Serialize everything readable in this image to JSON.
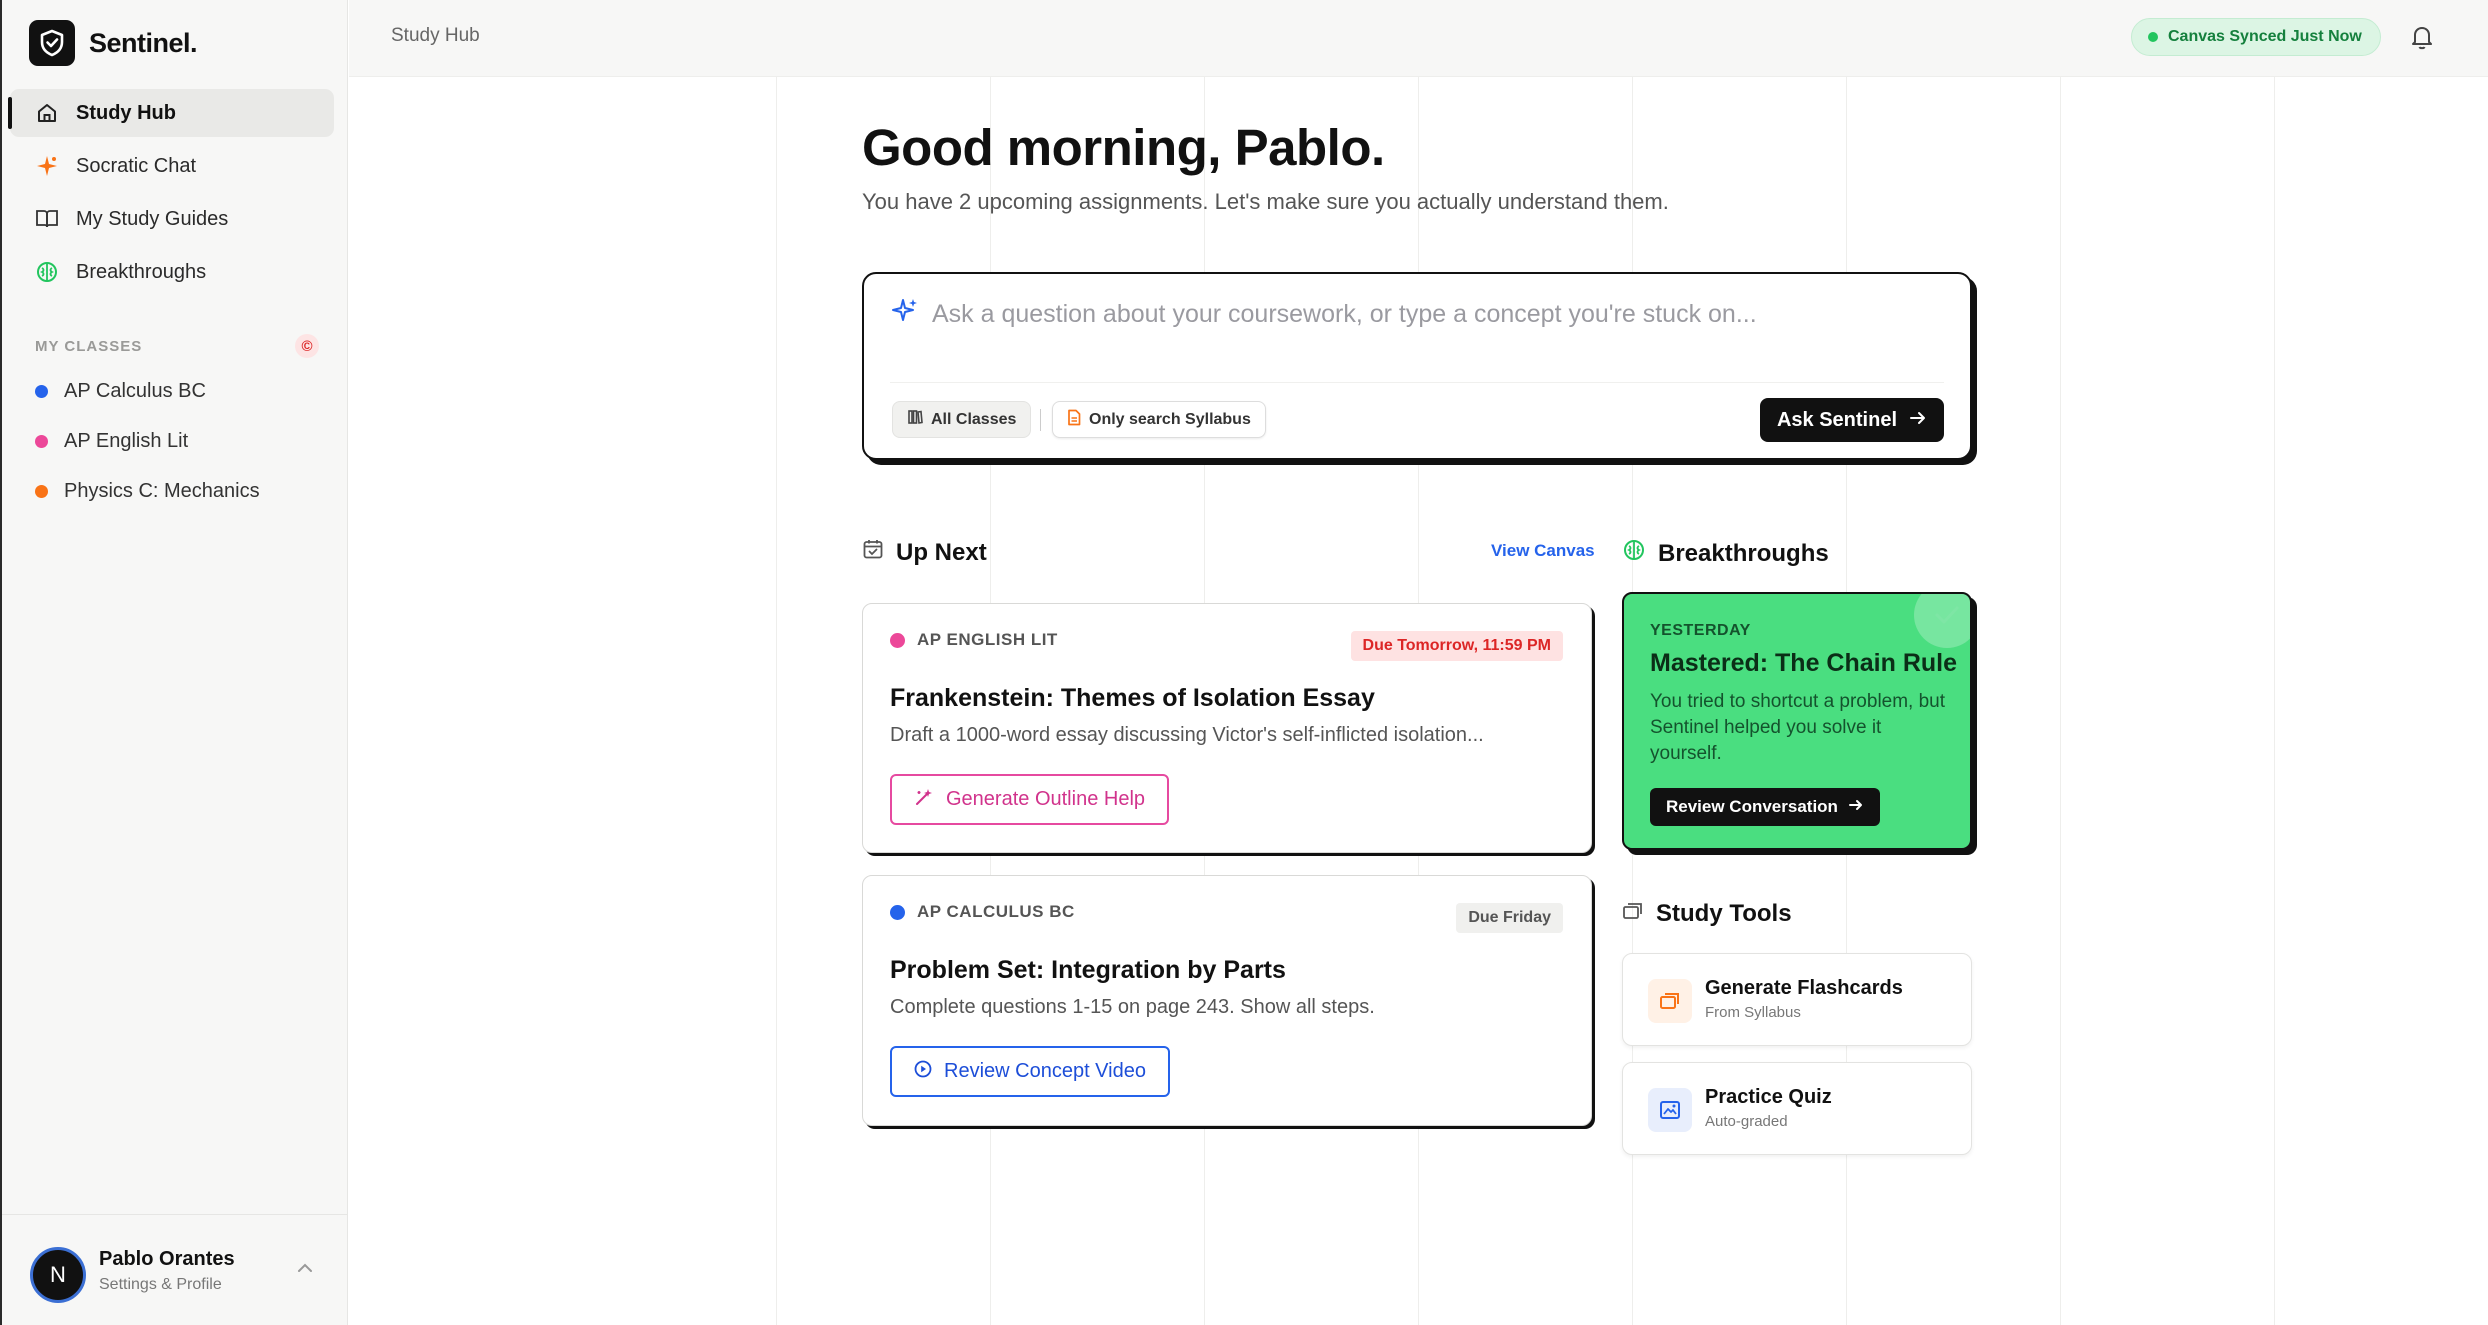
{
  "app": {
    "name": "Sentinel."
  },
  "sidebar": {
    "nav": [
      {
        "label": "Study Hub",
        "icon": "home-icon",
        "active": true
      },
      {
        "label": "Socratic Chat",
        "icon": "sparkle-chat-icon",
        "active": false
      },
      {
        "label": "My Study Guides",
        "icon": "book-icon",
        "active": false
      },
      {
        "label": "Breakthroughs",
        "icon": "brain-icon",
        "active": false
      }
    ],
    "classes_title": "MY CLASSES",
    "classes_badge": "©",
    "classes": [
      {
        "name": "AP Calculus BC",
        "color": "#2563eb"
      },
      {
        "name": "AP English Lit",
        "color": "#ec4899"
      },
      {
        "name": "Physics C: Mechanics",
        "color": "#f97316"
      }
    ],
    "profile": {
      "initial": "N",
      "name": "Pablo Orantes",
      "subtitle": "Settings & Profile"
    }
  },
  "topbar": {
    "breadcrumb": "Study Hub",
    "sync_status": "Canvas Synced Just Now"
  },
  "main": {
    "greeting": "Good morning, Pablo.",
    "subtitle": "You have 2 upcoming assignments. Let's make sure you actually understand them.",
    "ask": {
      "placeholder": "Ask a question about your coursework, or type a concept you're stuck on...",
      "value": "",
      "filter_all": "All Classes",
      "filter_syllabus": "Only search Syllabus",
      "button": "Ask Sentinel"
    },
    "up_next": {
      "title": "Up Next",
      "link": "View Canvas",
      "tasks": [
        {
          "class": "AP ENGLISH LIT",
          "class_color": "#ec4899",
          "due": "Due Tomorrow, 11:59 PM",
          "title": "Frankenstein: Themes of Isolation Essay",
          "desc": "Draft a 1000-word essay discussing Victor's self-inflicted isolation...",
          "button": "Generate Outline Help"
        },
        {
          "class": "AP CALCULUS BC",
          "class_color": "#2563eb",
          "due": "Due Friday",
          "title": "Problem Set: Integration by Parts",
          "desc": "Complete questions 1-15 on page 243. Show all steps.",
          "button": "Review Concept Video"
        }
      ]
    },
    "breakthroughs": {
      "title": "Breakthroughs",
      "card": {
        "label": "YESTERDAY",
        "title": "Mastered: The Chain Rule",
        "desc": "You tried to shortcut a problem, but Sentinel helped you solve it yourself.",
        "button": "Review Conversation"
      }
    },
    "study_tools": {
      "title": "Study Tools",
      "tools": [
        {
          "title": "Generate Flashcards",
          "subtitle": "From Syllabus",
          "icon": "flashcards-icon"
        },
        {
          "title": "Practice Quiz",
          "subtitle": "Auto-graded",
          "icon": "quiz-icon"
        }
      ]
    }
  },
  "colors": {
    "accent_green": "#4ade80",
    "brand_dark": "#111111",
    "link_blue": "#2563eb",
    "pink": "#ec4899"
  }
}
